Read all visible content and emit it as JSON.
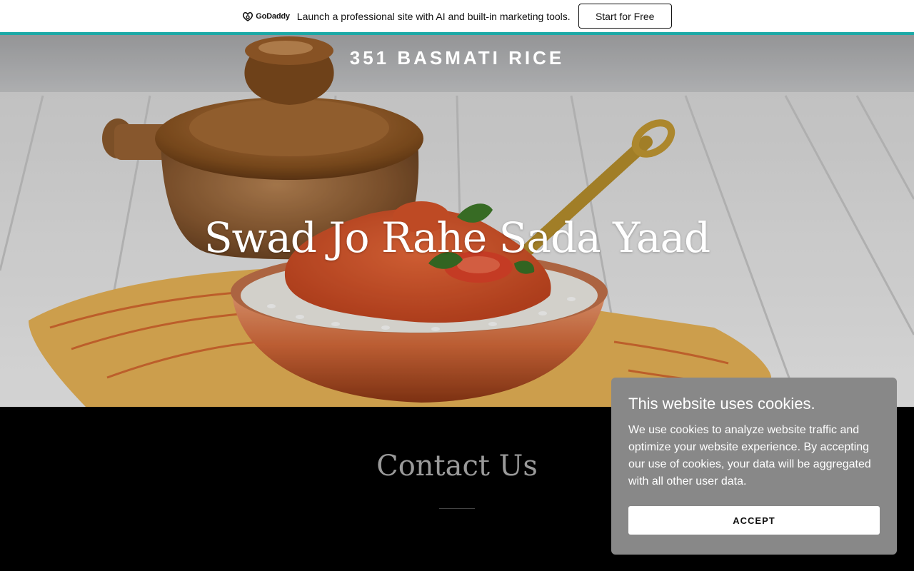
{
  "promo": {
    "logo_text": "GoDaddy",
    "message": "Launch a professional site with AI and built-in marketing tools.",
    "cta_label": "Start for Free",
    "accent_color": "#1ba9a6"
  },
  "hero": {
    "site_title": "351 BASMATI RICE",
    "tagline": "Swad Jo Rahe Sada Yaad"
  },
  "contact": {
    "heading": "Contact Us"
  },
  "cookie_banner": {
    "title": "This website uses cookies.",
    "body": "We use cookies to analyze website traffic and optimize your website experience. By accepting our use of cookies, your data will be aggregated with all other user data.",
    "accept_label": "ACCEPT",
    "background_color": "#888888"
  }
}
